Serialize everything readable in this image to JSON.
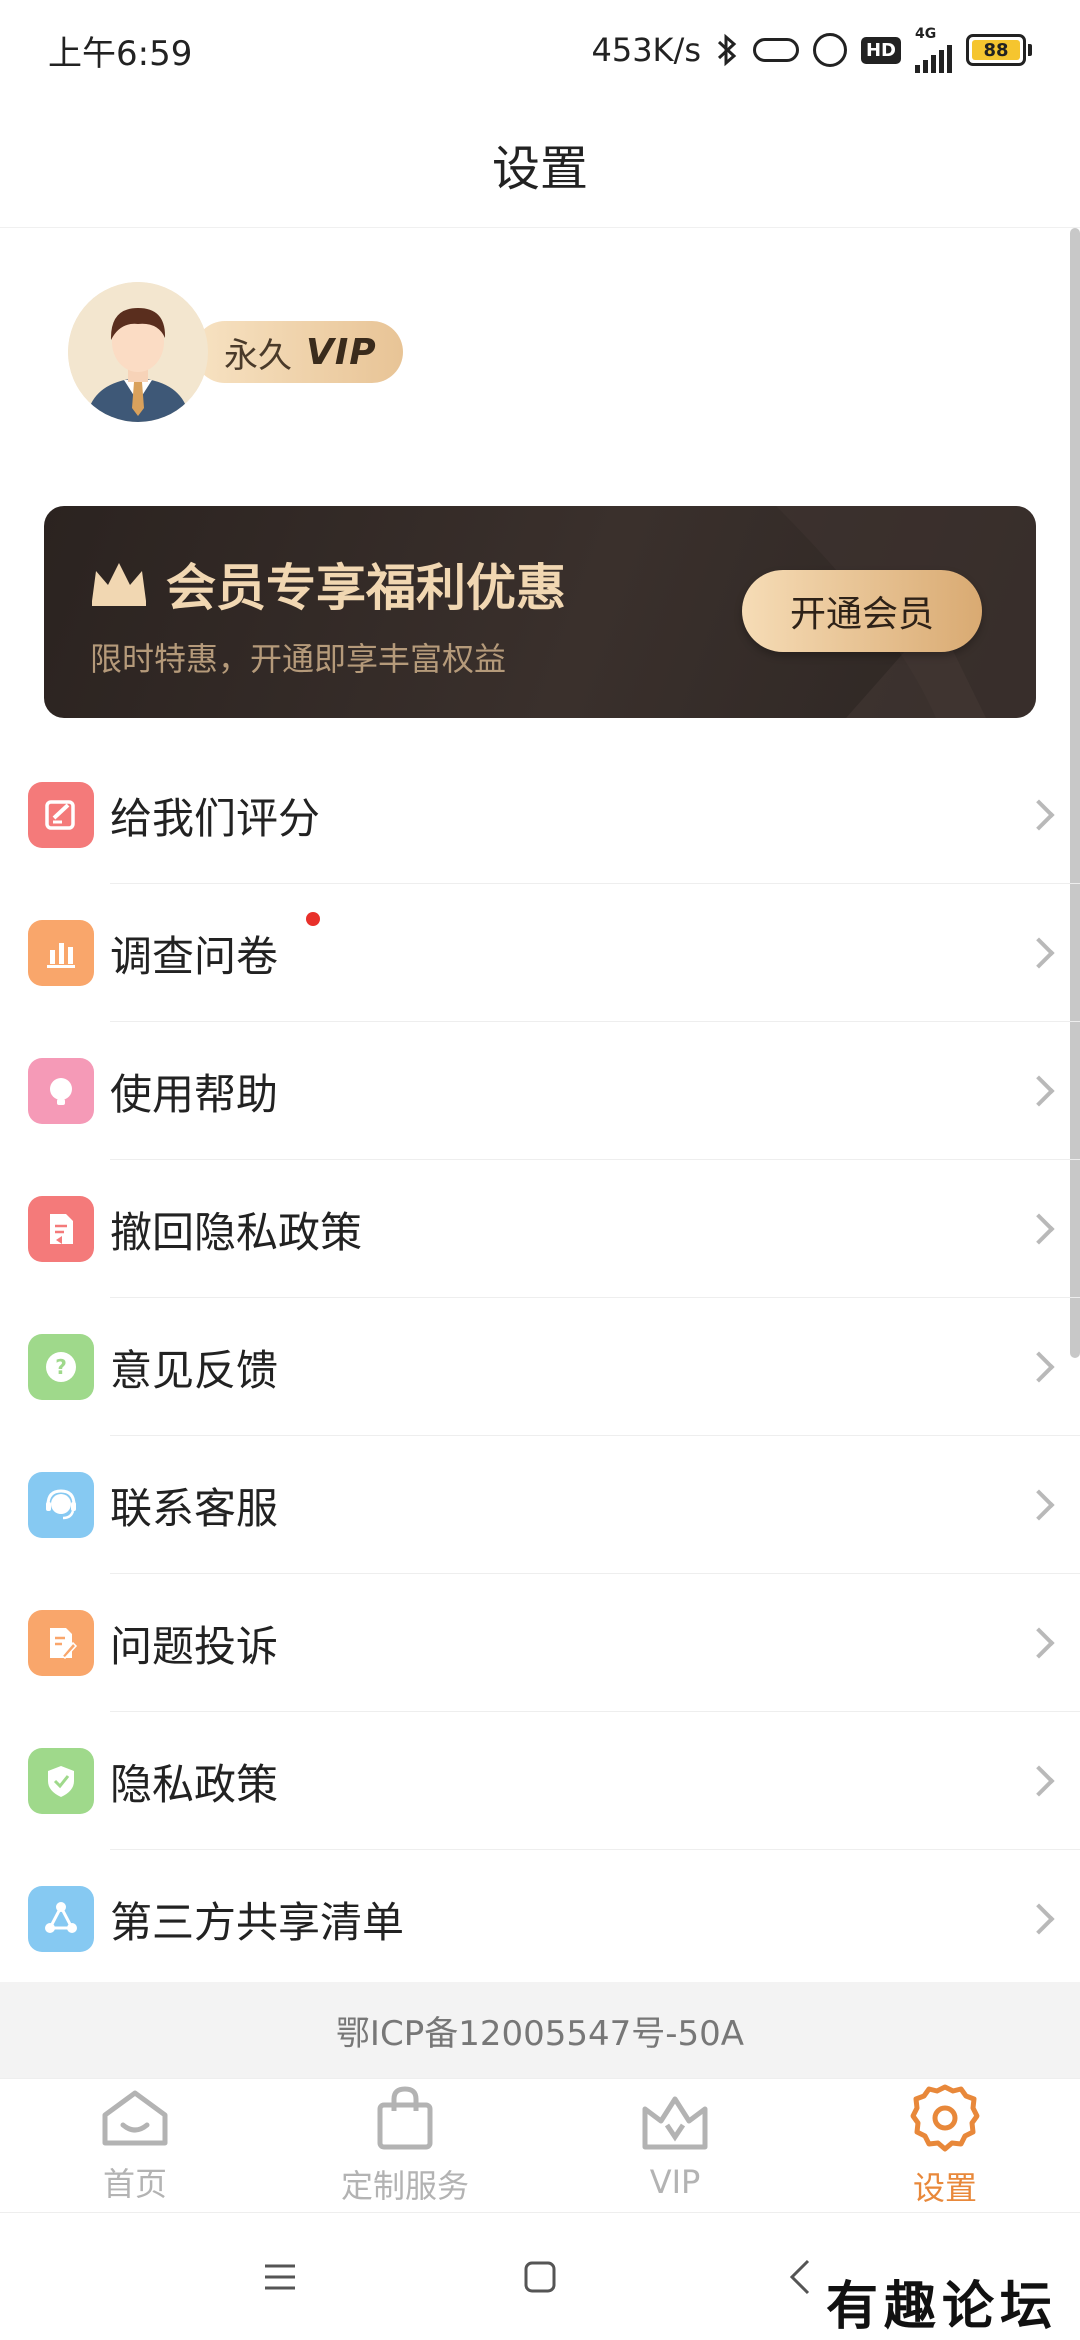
{
  "status_bar": {
    "time": "上午6:59",
    "network_speed": "453K/s",
    "network_type": "4G",
    "hd_label": "HD",
    "battery": "88",
    "icons": [
      "bluetooth-icon",
      "pill-icon",
      "alarm-icon",
      "hd-icon",
      "signal-icon",
      "battery-icon"
    ]
  },
  "header": {
    "title": "设置"
  },
  "profile": {
    "badge_text": "永久",
    "badge_vip": "VIP"
  },
  "banner": {
    "title": "会员专享福利优惠",
    "subtitle": "限时特惠，开通即享丰富权益",
    "button_label": "开通会员",
    "icon": "crown-icon"
  },
  "menu": {
    "items": [
      {
        "label": "给我们评分",
        "icon": "rate-edit-icon",
        "color": "#f47a7a"
      },
      {
        "label": "调查问卷",
        "icon": "survey-chart-icon",
        "color": "#f9a66b",
        "has_dot": true
      },
      {
        "label": "使用帮助",
        "icon": "help-bulb-icon",
        "color": "#f59ab7"
      },
      {
        "label": "撤回隐私政策",
        "icon": "revoke-document-icon",
        "color": "#f47a7a"
      },
      {
        "label": "意见反馈",
        "icon": "feedback-question-icon",
        "color": "#9fd98b"
      },
      {
        "label": "联系客服",
        "icon": "customer-service-icon",
        "color": "#86c9f2"
      },
      {
        "label": "问题投诉",
        "icon": "complaint-document-icon",
        "color": "#f9a66b"
      },
      {
        "label": "隐私政策",
        "icon": "privacy-shield-icon",
        "color": "#9fd98b"
      },
      {
        "label": "第三方共享清单",
        "icon": "share-network-icon",
        "color": "#86c9f2"
      }
    ]
  },
  "footer": {
    "icp": "鄂ICP备12005547号-50A"
  },
  "bottom_nav": {
    "items": [
      {
        "label": "首页",
        "icon": "home-icon",
        "active": false
      },
      {
        "label": "定制服务",
        "icon": "shopping-bag-icon",
        "active": false
      },
      {
        "label": "VIP",
        "icon": "vip-crown-icon",
        "active": false
      },
      {
        "label": "设置",
        "icon": "settings-gear-icon",
        "active": true
      }
    ]
  },
  "colors": {
    "accent": "#e8883a",
    "banner_bg": "#2b2320",
    "banner_gold": "#f1d7b2",
    "inactive_nav": "#b3b3b3"
  },
  "watermark": "有趣论坛"
}
